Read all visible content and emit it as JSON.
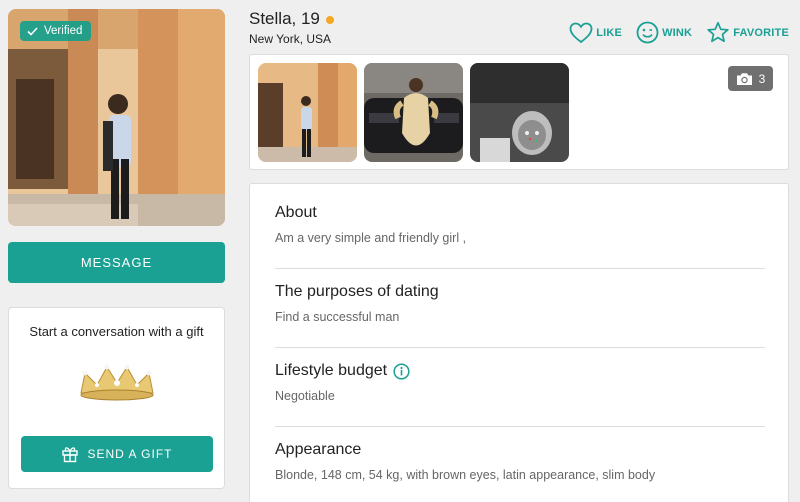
{
  "profile": {
    "verified_label": "Verified",
    "name": "Stella, 19",
    "location": "New York, USA",
    "status_color": "#f5a623"
  },
  "left": {
    "message_label": "MESSAGE",
    "gift_title": "Start a conversation with a gift",
    "gift_button_label": "SEND A GIFT",
    "gift_icon": "gift-icon",
    "gift_image": "crown"
  },
  "actions": [
    {
      "label": "LIKE",
      "icon": "heart-icon"
    },
    {
      "label": "WINK",
      "icon": "wink-smiley-icon"
    },
    {
      "label": "FAVORITE",
      "icon": "star-icon"
    }
  ],
  "photos": {
    "count": "3",
    "icon": "camera-icon"
  },
  "sections": [
    {
      "title": "About",
      "text": "Am a very simple and friendly girl ,"
    },
    {
      "title": "The purposes of dating",
      "text": "Find a successful man"
    },
    {
      "title": "Lifestyle budget",
      "text": "Negotiable",
      "icon": "info-icon"
    },
    {
      "title": "Appearance",
      "text": "Blonde, 148 cm, 54 kg, with brown eyes, latin appearance, slim body"
    }
  ],
  "colors": {
    "accent": "#1aa193",
    "background": "#efefef"
  }
}
